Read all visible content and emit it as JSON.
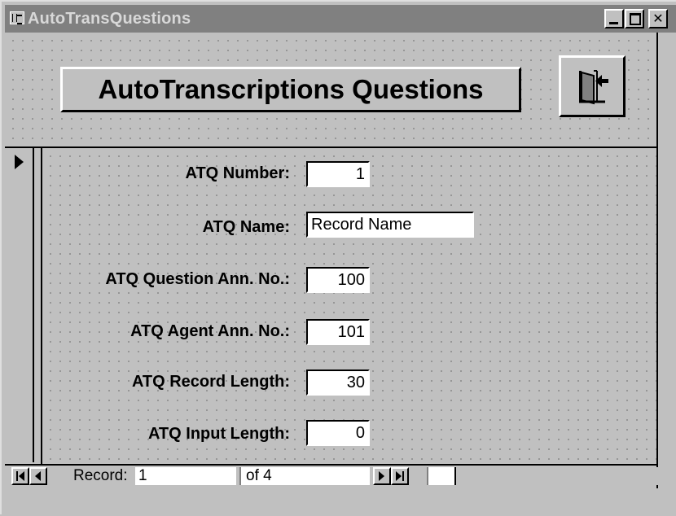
{
  "window": {
    "title": "AutoTransQuestions"
  },
  "header": {
    "form_title": "AutoTranscriptions Questions"
  },
  "fields": [
    {
      "label": "ATQ Number:",
      "value": "1"
    },
    {
      "label": "ATQ Name:",
      "value": "Record Name"
    },
    {
      "label": "ATQ Question Ann. No.:",
      "value": "100"
    },
    {
      "label": "ATQ Agent Ann. No.:",
      "value": "101"
    },
    {
      "label": "ATQ Record Length:",
      "value": "30"
    },
    {
      "label": "ATQ Input Length:",
      "value": "0"
    }
  ],
  "navigation": {
    "record_label": "Record:",
    "current_record": "1",
    "of_text": "of  4"
  },
  "icons": {
    "exit": "door-exit-icon",
    "record_selector": "record-selector-arrow-icon"
  },
  "colors": {
    "titlebar_inactive": "#808080",
    "face": "#c0c0c0"
  }
}
